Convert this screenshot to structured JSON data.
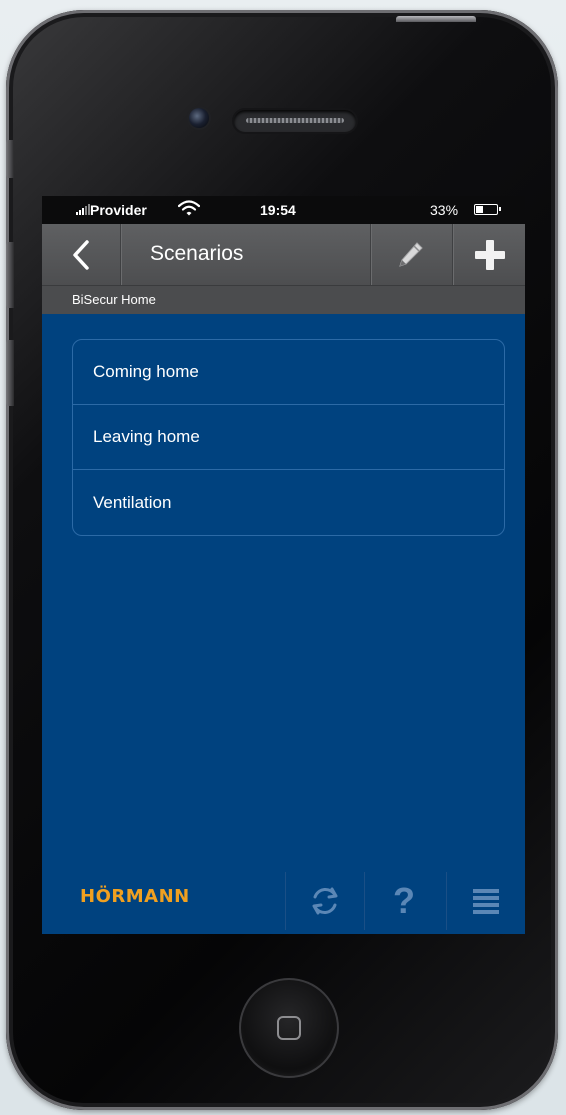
{
  "status_bar": {
    "provider": "Provider",
    "time": "19:54",
    "battery_percent": "33%"
  },
  "nav": {
    "title": "Scenarios",
    "back_icon": "chevron-left-icon",
    "edit_icon": "pencil-icon",
    "add_icon": "plus-icon"
  },
  "subheader": {
    "label": "BiSecur Home"
  },
  "scenarios": {
    "items": [
      {
        "label": "Coming home"
      },
      {
        "label": "Leaving home"
      },
      {
        "label": "Ventilation"
      }
    ]
  },
  "bottom_bar": {
    "brand": "HÖRMANN",
    "help_label": "?",
    "refresh_icon": "refresh-icon",
    "menu_icon": "menu-icon"
  },
  "colors": {
    "screen_bg": "#00427f",
    "navbar_bg": "#555658",
    "brand": "#f0a020",
    "toolbar_icon": "#5b87b6"
  }
}
